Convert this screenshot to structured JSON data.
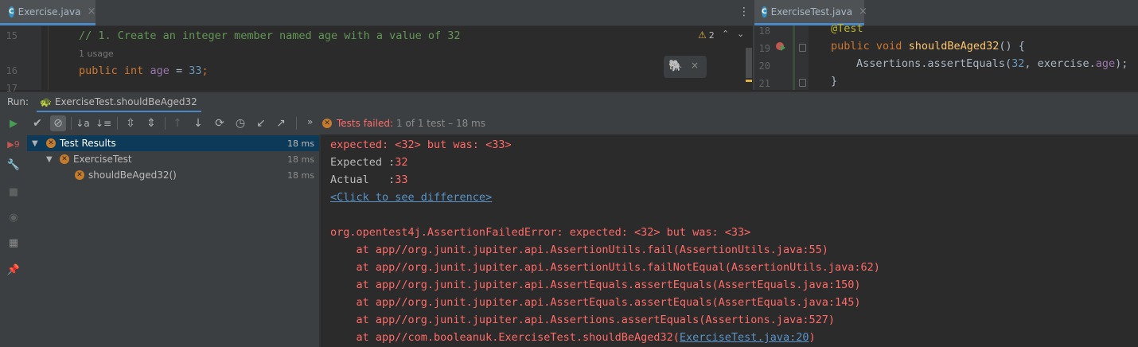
{
  "left_editor": {
    "tab_label": "Exercise.java",
    "tab_icon": "C",
    "warning_count": "2",
    "lines": [
      {
        "num": "15",
        "comment": "// 1. Create an integer member named age with a value of 32"
      },
      {
        "num": "",
        "inlay": "1 usage"
      },
      {
        "num": "16",
        "kw": "public",
        "type": "int",
        "field": "age",
        "eq": " = ",
        "value": "33",
        "end": ";"
      },
      {
        "num": "17"
      }
    ]
  },
  "right_editor": {
    "tab_label": "ExerciseTest.java",
    "tab_icon": "C",
    "lines": [
      {
        "num": "18",
        "annotation": "@Test"
      },
      {
        "num": "19",
        "kw1": "public",
        "kw2": "void",
        "method": "shouldBeAged32",
        "rest": "() {"
      },
      {
        "num": "20",
        "cls": "Assertions",
        "call": ".assertEquals(",
        "n": "32",
        "sep": ", exercise.",
        "field": "age",
        "end": ");"
      },
      {
        "num": "21",
        "brace": "}"
      }
    ]
  },
  "run_panel": {
    "label": "Run:",
    "tab_label": "ExerciseTest.shouldBeAged32",
    "status_title": "Tests failed:",
    "status_detail": "1 of 1 test – 18 ms",
    "more_label": "»"
  },
  "tree": [
    {
      "label": "Test Results",
      "time": "18 ms",
      "level": 0,
      "selected": true
    },
    {
      "label": "ExerciseTest",
      "time": "18 ms",
      "level": 1,
      "selected": false
    },
    {
      "label": "shouldBeAged32()",
      "time": "18 ms",
      "level": 2,
      "selected": false
    }
  ],
  "console": {
    "line1": "expected: <32> but was: <33>",
    "expected_label": "Expected :",
    "expected_value": "32",
    "actual_label": "Actual   :",
    "actual_value": "33",
    "diff_link": "<Click to see difference>",
    "error": "org.opentest4j.AssertionFailedError: expected: <32> but was: <33>",
    "stack": [
      "    at app//org.junit.jupiter.api.AssertionUtils.fail(AssertionUtils.java:55)",
      "    at app//org.junit.jupiter.api.AssertionUtils.failNotEqual(AssertionUtils.java:62)",
      "    at app//org.junit.jupiter.api.AssertEquals.assertEquals(AssertEquals.java:150)",
      "    at app//org.junit.jupiter.api.AssertEquals.assertEquals(AssertEquals.java:145)",
      "    at app//org.junit.jupiter.api.Assertions.assertEquals(Assertions.java:527)"
    ],
    "last_prefix": "    at app//com.booleanuk.ExerciseTest.shouldBeAged32(",
    "last_link": "ExerciseTest.java:20",
    "last_suffix": ")"
  },
  "colors": {
    "error": "#ff6b68",
    "link": "#5894c8",
    "selection": "#0d3a58",
    "fail_icon": "#c77c2c"
  }
}
